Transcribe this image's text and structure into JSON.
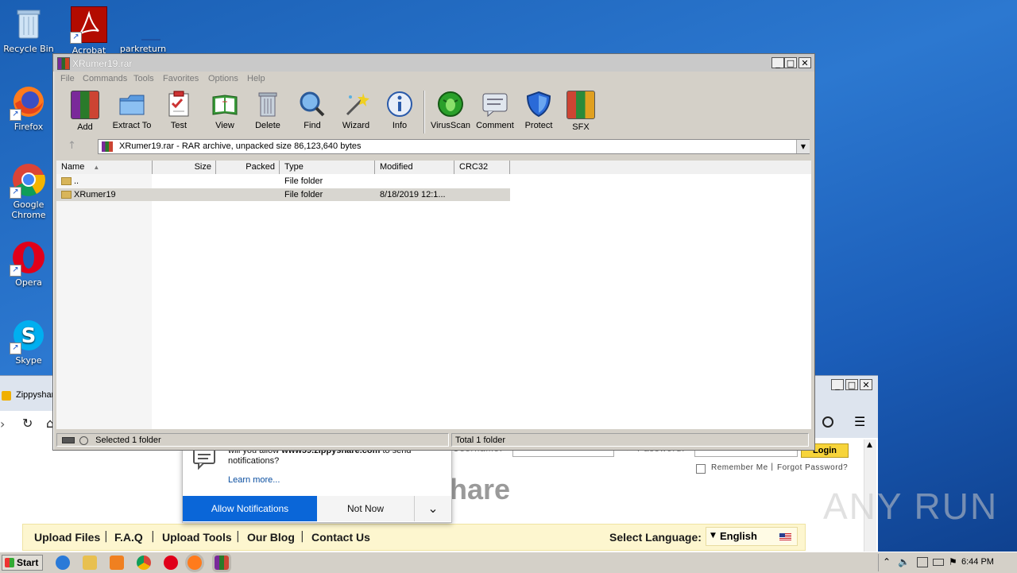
{
  "desktop": {
    "icons": [
      {
        "label": "Recycle Bin"
      },
      {
        "label": "Acrobat"
      },
      {
        "label": "parkreturn"
      },
      {
        "label": "Firefox"
      },
      {
        "label": "Google Chrome"
      },
      {
        "label": "Opera"
      },
      {
        "label": "Skype"
      }
    ]
  },
  "browser": {
    "tab_title": "Zippyshar",
    "site_logo_fragment": "hare",
    "password_label": "Password:",
    "username_label": "Username:",
    "login_button": "Login",
    "remember_me": "Remember Me",
    "forgot_password": "Forgot Password?",
    "nav": [
      "Upload Files",
      "F.A.Q",
      "Upload Tools",
      "Our Blog",
      "Contact Us"
    ],
    "select_language_label": "Select Language:",
    "language_value": "English"
  },
  "notification": {
    "question_prefix": "will you allow",
    "site": "www59.zippyshare.com",
    "question_suffix": "to send",
    "question_line2": "notifications?",
    "learn_more": "Learn more...",
    "allow_label": "Allow Notifications",
    "not_now_label": "Not Now"
  },
  "winrar": {
    "title": "XRumer19.rar",
    "menu": [
      "File",
      "Commands",
      "Tools",
      "Favorites",
      "Options",
      "Help"
    ],
    "toolbar": [
      {
        "label": "Add",
        "icon": "add-icon"
      },
      {
        "label": "Extract To",
        "icon": "extract-icon"
      },
      {
        "label": "Test",
        "icon": "test-icon"
      },
      {
        "label": "View",
        "icon": "view-icon"
      },
      {
        "label": "Delete",
        "icon": "delete-icon"
      },
      {
        "label": "Find",
        "icon": "find-icon"
      },
      {
        "label": "Wizard",
        "icon": "wizard-icon"
      },
      {
        "label": "Info",
        "icon": "info-icon"
      },
      {
        "label": "VirusScan",
        "icon": "virusscan-icon"
      },
      {
        "label": "Comment",
        "icon": "comment-icon"
      },
      {
        "label": "Protect",
        "icon": "protect-icon"
      },
      {
        "label": "SFX",
        "icon": "sfx-icon"
      }
    ],
    "address": "XRumer19.rar - RAR archive, unpacked size 86,123,640 bytes",
    "columns": [
      "Name",
      "Size",
      "Packed",
      "Type",
      "Modified",
      "CRC32"
    ],
    "rows": [
      {
        "name": "..",
        "size": "",
        "packed": "",
        "type": "File folder",
        "modified": "",
        "crc": ""
      },
      {
        "name": "XRumer19",
        "size": "",
        "packed": "",
        "type": "File folder",
        "modified": "8/18/2019 12:1...",
        "crc": ""
      }
    ],
    "status_left": "Selected 1 folder",
    "status_right": "Total 1 folder"
  },
  "taskbar": {
    "start_label": "Start",
    "clock": "6:44 PM"
  },
  "watermark": "ANY RUN"
}
